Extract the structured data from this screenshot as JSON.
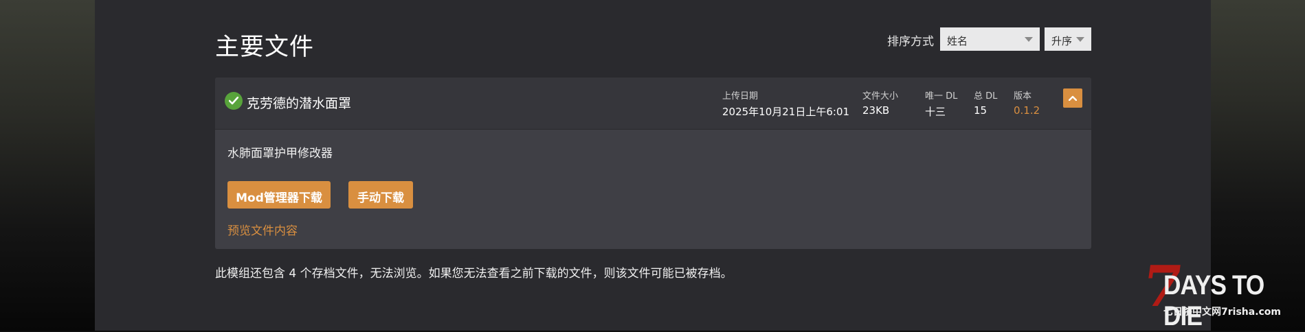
{
  "page": {
    "title": "主要文件",
    "sort_label": "排序方式",
    "sort_value": "姓名",
    "order_value": "升序"
  },
  "file": {
    "name": "克劳德的潜水面罩",
    "upload_date_label": "上传日期",
    "upload_date": "2025年10月21日上午6:01",
    "size_label": "文件大小",
    "size": "23KB",
    "unique_dl_label": "唯一 DL",
    "unique_dl": "十三",
    "total_dl_label": "总 DL",
    "total_dl": "15",
    "version_label": "版本",
    "version": "0.1.2",
    "description": "水肺面罩护甲修改器",
    "mod_manager_button": "Mod管理器下载",
    "manual_button": "手动下载",
    "preview_link": "预览文件内容"
  },
  "archive_note": "此模组还包含 4 个存档文件，无法浏览。如果您无法查看之前下载的文件，则该文件可能已被存档。",
  "watermark": {
    "seven": "7",
    "title": "DAYS TO DIE",
    "subtitle": "七日杀中文网7risha.com"
  },
  "colors": {
    "accent": "#d98f40",
    "success": "#58a33b",
    "panel": "#2a2a2e",
    "card": "#3f3f45"
  },
  "icons": {
    "status": "check-circle-icon",
    "collapse": "chevron-up-icon",
    "dropdown": "caret-down-icon"
  }
}
